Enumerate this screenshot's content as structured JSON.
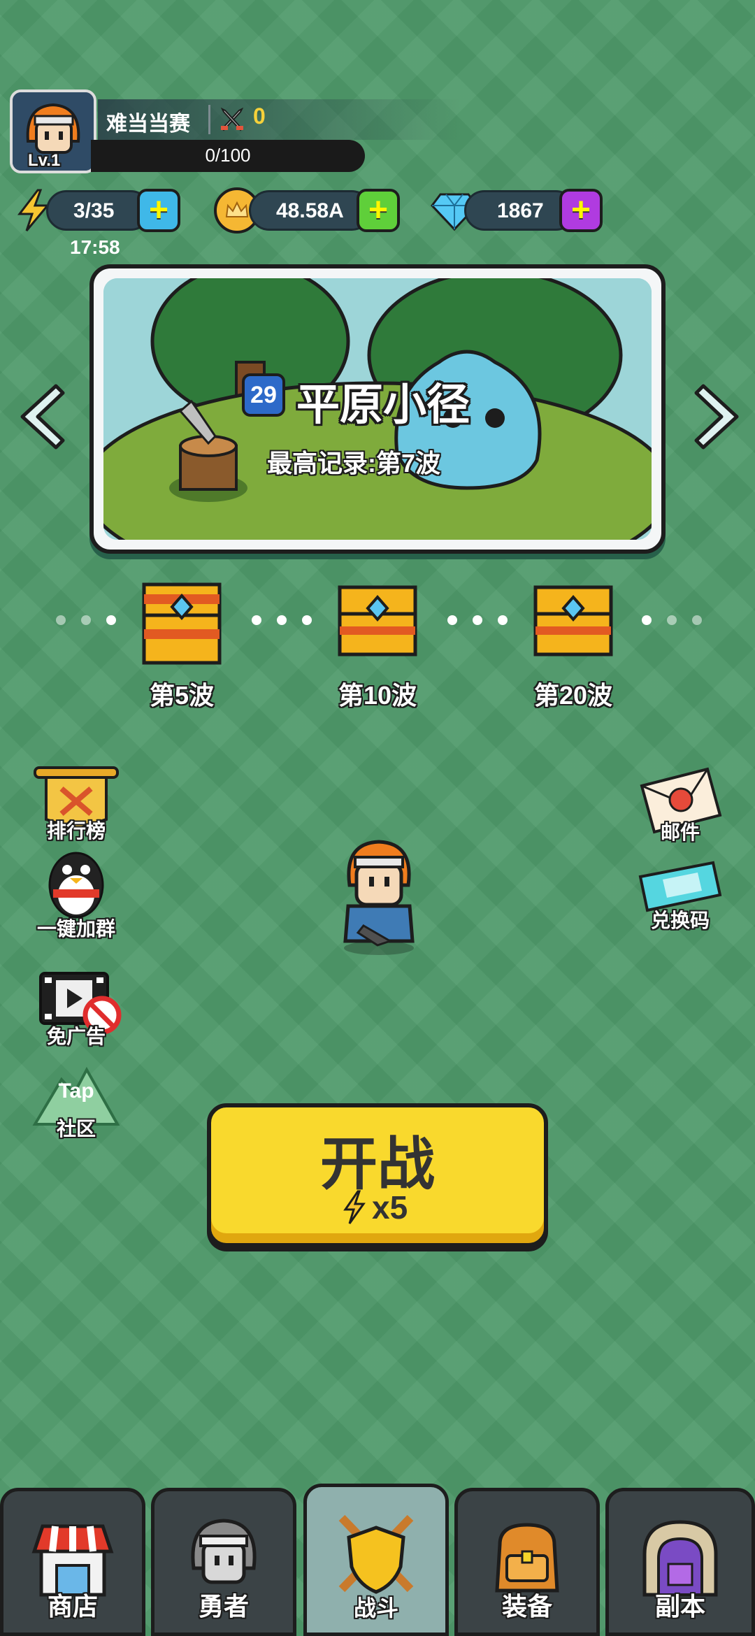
{
  "player": {
    "name": "难当当赛",
    "level": "Lv.1",
    "swords_count": "0",
    "xp_text": "0/100"
  },
  "resources": {
    "energy": "3/35",
    "energy_timer": "17:58",
    "gold": "48.58A",
    "diamonds": "1867"
  },
  "stage": {
    "number": "29",
    "name": "平原小径",
    "best_record": "最高记录:第7波"
  },
  "rewards": [
    {
      "label": "第5波"
    },
    {
      "label": "第10波"
    },
    {
      "label": "第20波"
    }
  ],
  "left_menu": {
    "ranking": "排行榜",
    "join_group": "一键加群",
    "no_ads": "免广告",
    "community": "社区",
    "tap_logo": "Tap"
  },
  "right_menu": {
    "mail": "邮件",
    "redeem": "兑换码"
  },
  "battle": {
    "label": "开战",
    "cost": "x5"
  },
  "bottom_nav": {
    "tabs": [
      {
        "label": "商店"
      },
      {
        "label": "勇者"
      },
      {
        "label": "战斗"
      },
      {
        "label": "装备"
      },
      {
        "label": "副本"
      }
    ],
    "active_index": 2
  },
  "colors": {
    "background": "#4f9a6a",
    "battle_button": "#f9d92d",
    "plus_energy": "#3fb8e8",
    "plus_gold": "#5fcf3a",
    "plus_diamond": "#b03be0"
  }
}
